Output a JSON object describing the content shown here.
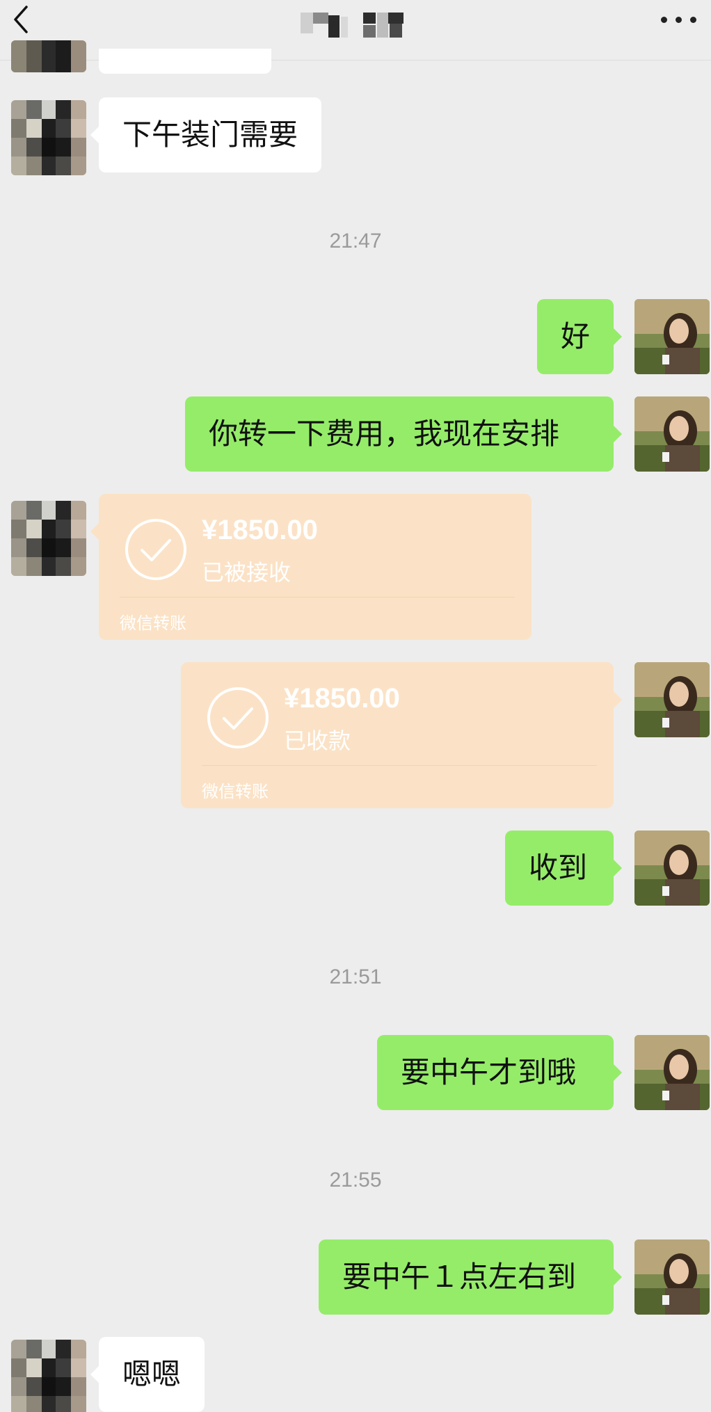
{
  "colors": {
    "background": "#ededed",
    "incoming_bubble": "#ffffff",
    "outgoing_bubble": "#95ec69",
    "transfer_card": "#fbe2c6",
    "timestamp_text": "#9a9a9a"
  },
  "header": {
    "back_icon": "chevron-left-icon",
    "more_icon": "more-dots-icon"
  },
  "messages": {
    "m1": {
      "text": "下午装门需要"
    },
    "t1": {
      "text": "21:47"
    },
    "m2": {
      "text": "好"
    },
    "m3": {
      "text": "你转一下费用，我现在安排"
    },
    "tr1": {
      "amount": "¥1850.00",
      "status": "已被接收",
      "source": "微信转账"
    },
    "tr2": {
      "amount": "¥1850.00",
      "status": "已收款",
      "source": "微信转账"
    },
    "m4": {
      "text": "收到"
    },
    "t2": {
      "text": "21:51"
    },
    "m5": {
      "text": "要中午才到哦"
    },
    "t3": {
      "text": "21:55"
    },
    "m6": {
      "text": "要中午１点左右到"
    },
    "m7": {
      "text": "嗯嗯"
    }
  }
}
